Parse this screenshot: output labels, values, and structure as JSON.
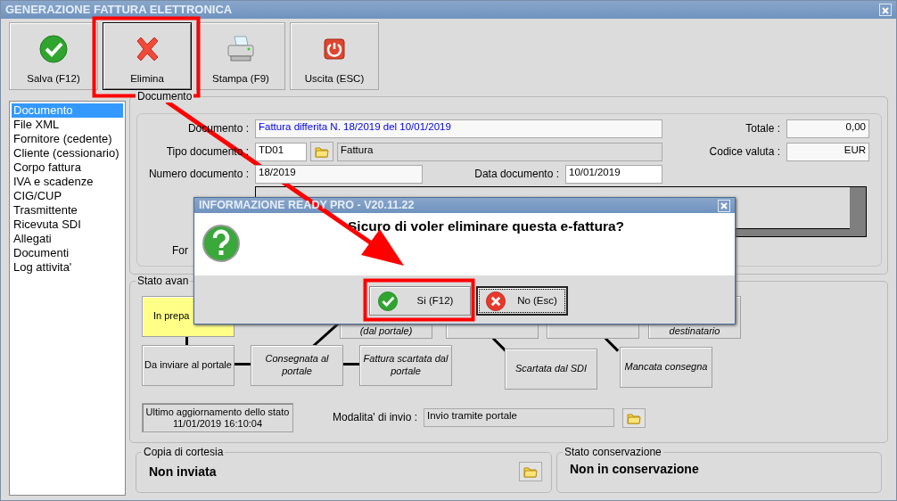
{
  "window": {
    "title": "GENERAZIONE FATTURA ELETTRONICA"
  },
  "toolbar": {
    "buttons": [
      {
        "label": "Salva (F12)",
        "focused": false
      },
      {
        "label": "Elimina",
        "focused": true
      },
      {
        "label": "Stampa (F9)",
        "focused": false
      },
      {
        "label": "Uscita (ESC)",
        "focused": false
      }
    ]
  },
  "sidebar": {
    "items": [
      {
        "label": "Documento",
        "selected": true
      },
      {
        "label": "File XML",
        "selected": false
      },
      {
        "label": "Fornitore (cedente)",
        "selected": false
      },
      {
        "label": "Cliente (cessionario)",
        "selected": false
      },
      {
        "label": "Corpo fattura",
        "selected": false
      },
      {
        "label": "IVA e scadenze",
        "selected": false
      },
      {
        "label": "CIG/CUP",
        "selected": false
      },
      {
        "label": "Trasmittente",
        "selected": false
      },
      {
        "label": "Ricevuta SDI",
        "selected": false
      },
      {
        "label": "Allegati",
        "selected": false
      },
      {
        "label": "Documenti",
        "selected": false
      },
      {
        "label": "Log attivita'",
        "selected": false
      }
    ]
  },
  "document": {
    "title": "Documento",
    "documento_label": "Documento :",
    "documento_value": "Fattura differita N. 18/2019 del 10/01/2019",
    "tipo_label": "Tipo documento :",
    "tipo_code": "TD01",
    "tipo_description": "Fattura",
    "numero_label": "Numero documento :",
    "numero_value": "18/2019",
    "data_label": "Data documento :",
    "data_value": "10/01/2019",
    "totale_label": "Totale :",
    "totale_value": "0,00",
    "valuta_label": "Codice valuta :",
    "valuta_value": "EUR",
    "fornitore_label": "For"
  },
  "status": {
    "title": "Stato avan",
    "nodes": [
      {
        "text": "In prepa",
        "kind": "current"
      },
      {
        "text": "(dal portale)",
        "kind": "italic"
      },
      {
        "kind": "italic"
      },
      {
        "kind": "italic"
      },
      {
        "text": "destinatario",
        "kind": "italic"
      },
      {
        "text": "Da inviare al portale",
        "kind": "plain"
      },
      {
        "text": "Consegnata al portale",
        "kind": "italic"
      },
      {
        "text": "Fattura scartata dal portale",
        "kind": "italic"
      },
      {
        "text": "Scartata dal SDI",
        "kind": "italic"
      },
      {
        "text": "Mancata consegna",
        "kind": "italic"
      }
    ],
    "last_update": [
      "Ultimo aggiornamento dello stato",
      "11/01/2019 16:10:04"
    ],
    "modalita_label": "Modalita' di invio :",
    "modalita_value": "Invio tramite portale"
  },
  "copia_cortesia": {
    "title": "Copia di cortesia",
    "value": "Non inviata"
  },
  "conservazione": {
    "title": "Stato conservazione",
    "value": "Non in conservazione"
  },
  "dialog": {
    "title": "INFORMAZIONE READY PRO - V20.11.22",
    "message": "Sicuro di voler eliminare questa e-fattura?",
    "buttons": [
      {
        "label": "Si (F12)",
        "focused": false
      },
      {
        "label": "No (Esc)",
        "focused": true
      }
    ]
  }
}
